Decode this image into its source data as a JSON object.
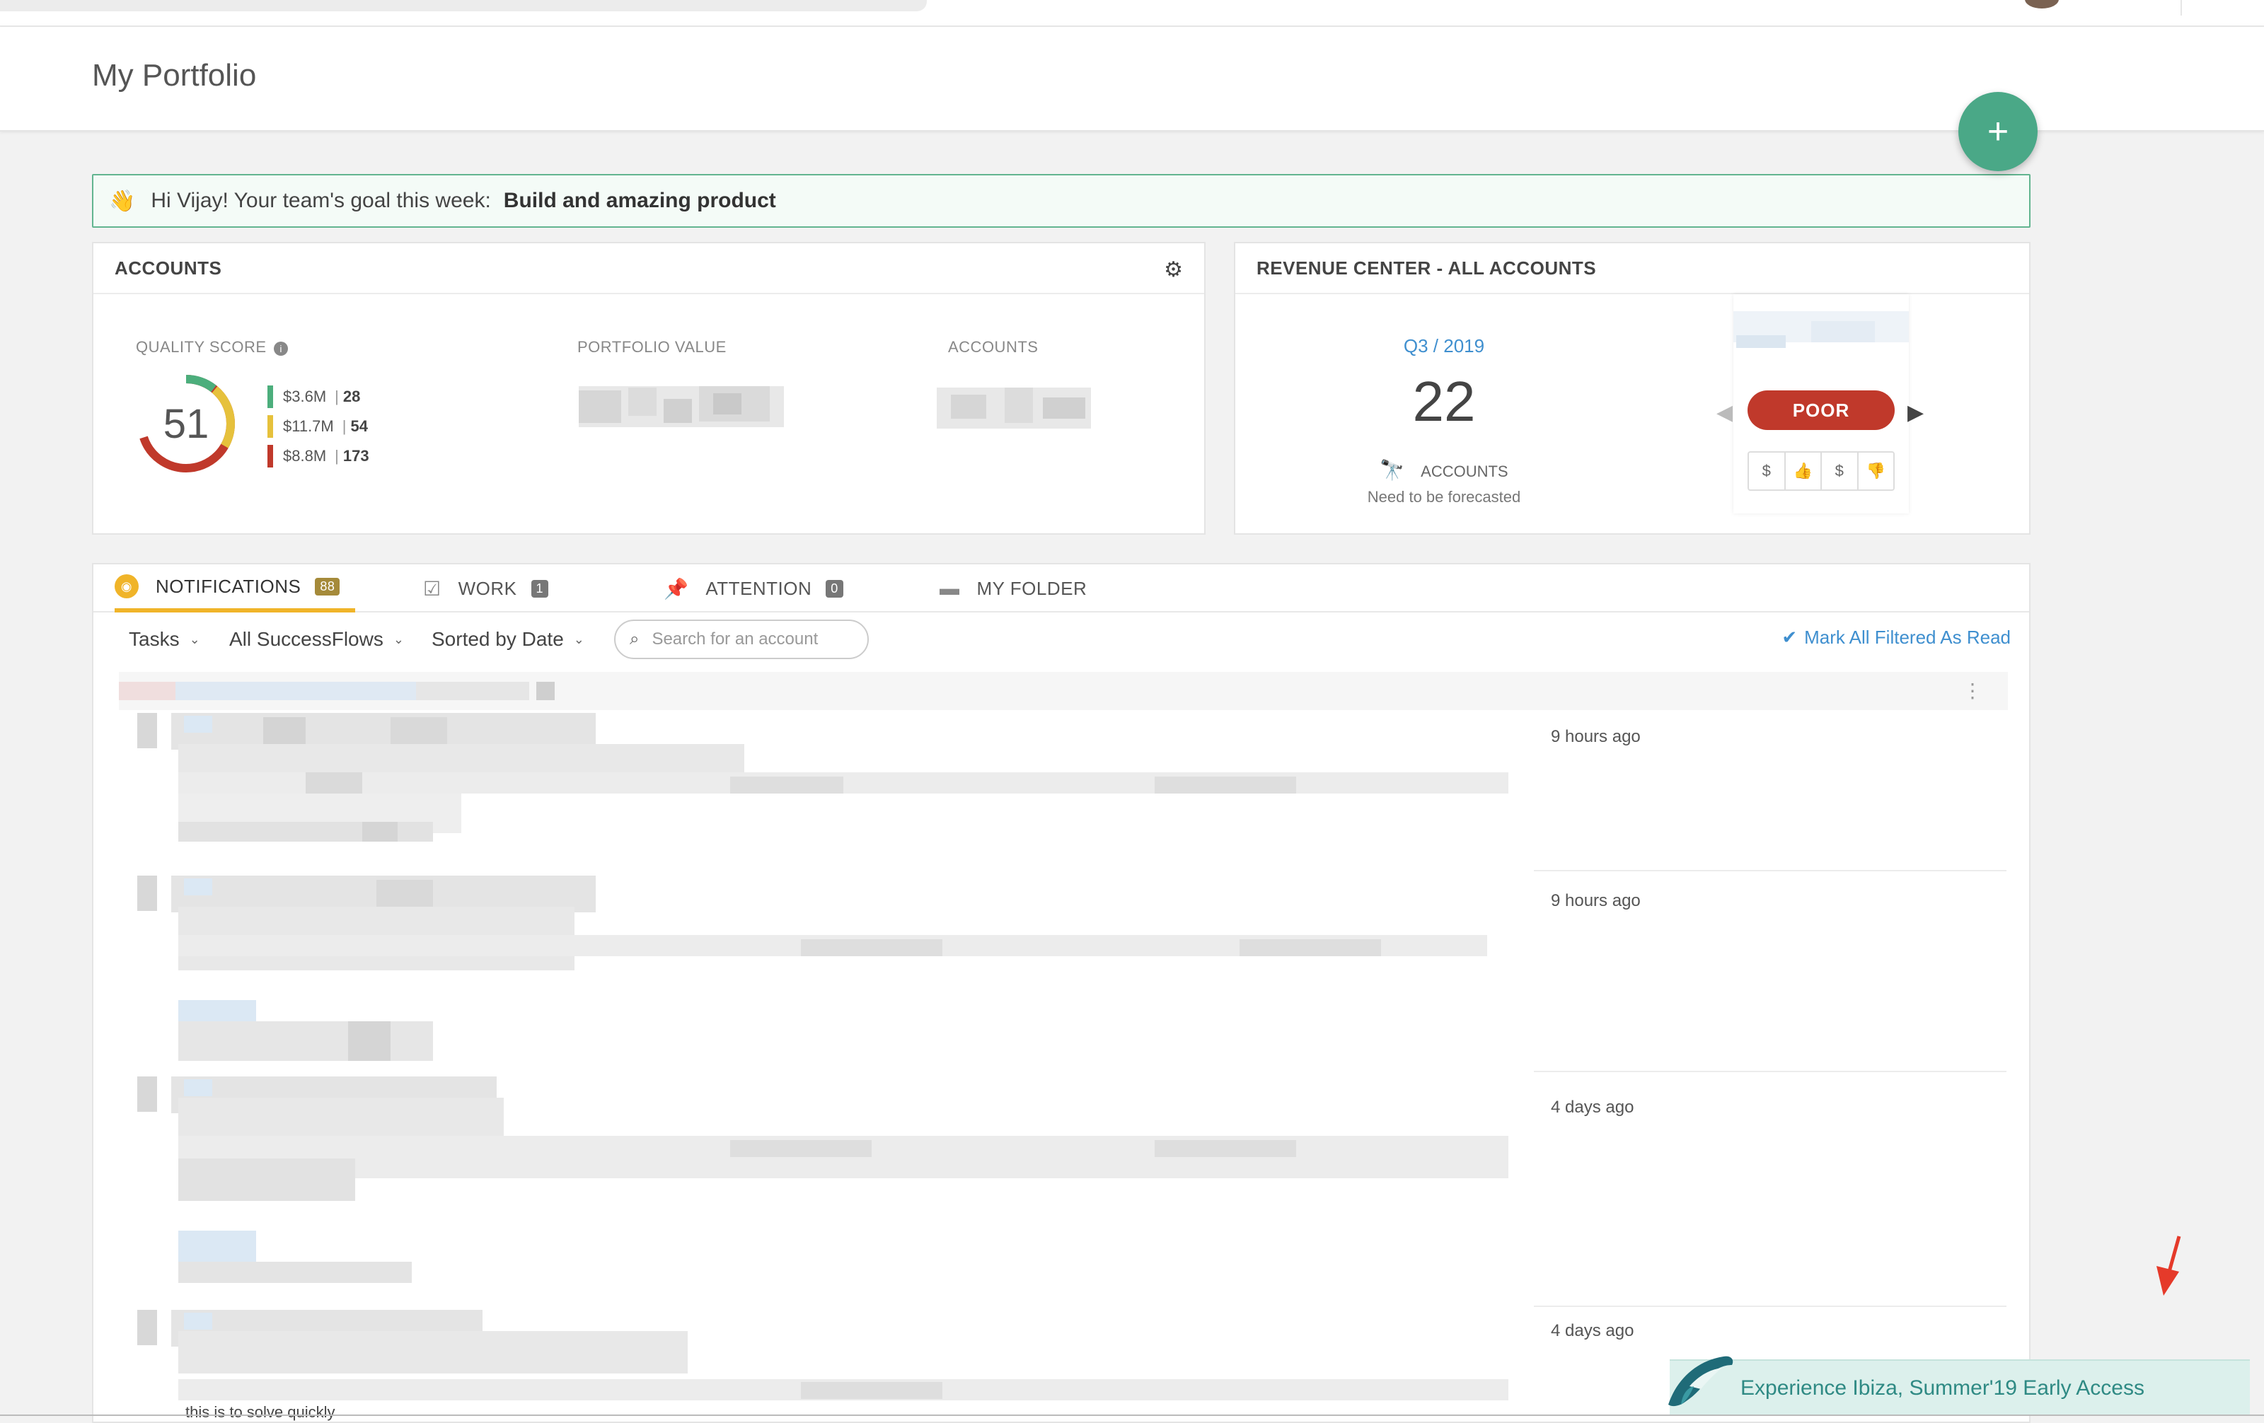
{
  "page": {
    "title": "My Portfolio"
  },
  "colors": {
    "accent_green": "#4aa887",
    "link_blue": "#3f8fcf",
    "tab_active": "#f0b429",
    "poor_red": "#c0392b",
    "score_green": "#4cae7c",
    "score_yellow": "#e6c13c",
    "score_red": "#c0392b"
  },
  "fab": {
    "icon": "plus-icon",
    "label": "+"
  },
  "goal": {
    "icon": "waving-hand-icon",
    "emoji": "👋",
    "greeting": "Hi Vijay! Your team's goal this week:",
    "value": "Build and amazing product"
  },
  "accounts": {
    "title": "ACCOUNTS",
    "settings_icon": "gear-icon",
    "quality_label": "QUALITY SCORE",
    "info_icon": "info-icon",
    "score": "51",
    "legend": [
      {
        "amount": "$3.6M",
        "count": "28",
        "color": "#4cae7c"
      },
      {
        "amount": "$11.7M",
        "count": "54",
        "color": "#e6c13c"
      },
      {
        "amount": "$8.8M",
        "count": "173",
        "color": "#c0392b"
      }
    ],
    "portfolio_value_label": "PORTFOLIO VALUE",
    "accounts_label": "ACCOUNTS"
  },
  "revenue": {
    "title": "REVENUE CENTER - ALL ACCOUNTS",
    "period": "Q3 / 2019",
    "count": "22",
    "accounts_label": "ACCOUNTS",
    "scope_icon": "telescope-icon",
    "need": "Need to be forecasted",
    "status": "POOR",
    "mini_icons": [
      "dollar-shield-icon",
      "thumbs-up-icon",
      "dollar-shield-icon",
      "thumbs-down-icon"
    ]
  },
  "tabs": [
    {
      "label": "NOTIFICATIONS",
      "badge": "88",
      "icon": "bell-icon",
      "active": true
    },
    {
      "label": "WORK",
      "badge": "1",
      "icon": "checkbox-icon",
      "active": false
    },
    {
      "label": "ATTENTION",
      "badge": "0",
      "icon": "pin-icon",
      "active": false
    },
    {
      "label": "MY FOLDER",
      "badge": "",
      "icon": "folder-icon",
      "active": false
    }
  ],
  "filters": {
    "type": "Tasks",
    "flows": "All SuccessFlows",
    "sort": "Sorted by Date",
    "search_placeholder": "Search for an account",
    "mark_read": "Mark All Filtered As Read"
  },
  "notifications": [
    {
      "time": "9 hours ago"
    },
    {
      "time": "9 hours ago"
    },
    {
      "time": "4 days ago"
    },
    {
      "time": "4 days ago"
    }
  ],
  "last_text": "this is to solve quickly",
  "promo": {
    "text": "Experience Ibiza, Summer'19 Early Access",
    "icon": "orca-icon"
  }
}
